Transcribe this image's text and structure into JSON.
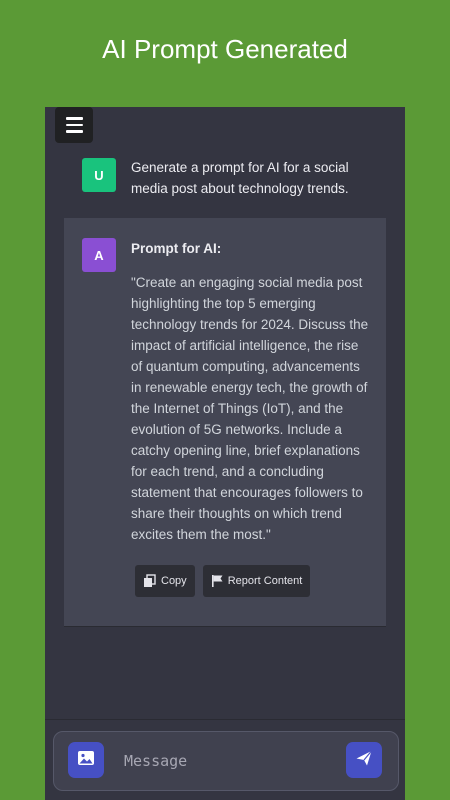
{
  "page": {
    "title": "AI Prompt Generated"
  },
  "chat": {
    "user_message": {
      "avatar_letter": "U",
      "avatar_color": "#19c37d",
      "text": "Generate a prompt for AI for a social media post about technology trends."
    },
    "ai_message": {
      "avatar_letter": "A",
      "avatar_color": "#8a4fd3",
      "heading": "Prompt for AI:",
      "body": "\"Create an engaging social media post highlighting the top 5 emerging technology trends for 2024. Discuss the impact of artificial intelligence, the rise of quantum computing, advancements in renewable energy tech, the growth of the Internet of Things (IoT), and the evolution of 5G networks. Include a catchy opening line, brief explanations for each trend, and a concluding statement that encourages followers to share their thoughts on which trend excites them the most.\"",
      "actions": {
        "copy_label": "Copy",
        "report_label": "Report Content"
      }
    }
  },
  "composer": {
    "placeholder": "Message",
    "value": ""
  },
  "icons": {
    "menu": "menu-icon",
    "copy": "copy-icon",
    "report": "flag-icon",
    "image": "image-icon",
    "send": "send-icon"
  },
  "colors": {
    "app_background": "#5b9a36",
    "chat_background": "#343541",
    "ai_message_background": "#444654",
    "accent": "#4650c4"
  }
}
